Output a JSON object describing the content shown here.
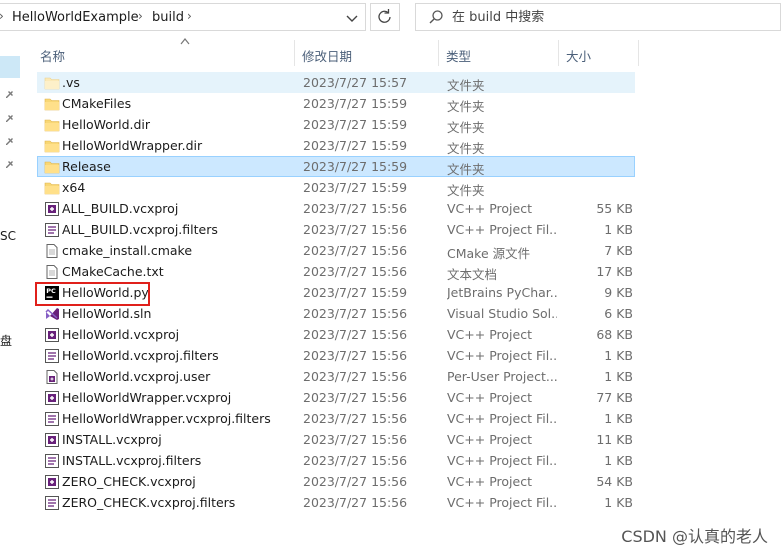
{
  "breadcrumb": {
    "items": [
      "HelloWorldExample",
      "build"
    ]
  },
  "search": {
    "placeholder": "在 build 中搜索"
  },
  "nav": {
    "partial_labels": [
      "SC",
      "盘"
    ]
  },
  "columns": {
    "name": "名称",
    "date": "修改日期",
    "type": "类型",
    "size": "大小"
  },
  "files": [
    {
      "name": ".vs",
      "date": "2023/7/27 15:57",
      "type": "文件夹",
      "size": "",
      "icon": "folder-light-icon",
      "state": "hover"
    },
    {
      "name": "CMakeFiles",
      "date": "2023/7/27 15:59",
      "type": "文件夹",
      "size": "",
      "icon": "folder-icon",
      "state": ""
    },
    {
      "name": "HelloWorld.dir",
      "date": "2023/7/27 15:59",
      "type": "文件夹",
      "size": "",
      "icon": "folder-icon",
      "state": ""
    },
    {
      "name": "HelloWorldWrapper.dir",
      "date": "2023/7/27 15:59",
      "type": "文件夹",
      "size": "",
      "icon": "folder-icon",
      "state": ""
    },
    {
      "name": "Release",
      "date": "2023/7/27 15:59",
      "type": "文件夹",
      "size": "",
      "icon": "folder-icon",
      "state": "selected"
    },
    {
      "name": "x64",
      "date": "2023/7/27 15:59",
      "type": "文件夹",
      "size": "",
      "icon": "folder-icon",
      "state": ""
    },
    {
      "name": "ALL_BUILD.vcxproj",
      "date": "2023/7/27 15:56",
      "type": "VC++ Project",
      "size": "55 KB",
      "icon": "vcxproj-icon",
      "state": ""
    },
    {
      "name": "ALL_BUILD.vcxproj.filters",
      "date": "2023/7/27 15:56",
      "type": "VC++ Project Fil...",
      "size": "1 KB",
      "icon": "filters-icon",
      "state": ""
    },
    {
      "name": "cmake_install.cmake",
      "date": "2023/7/27 15:56",
      "type": "CMake 源文件",
      "size": "7 KB",
      "icon": "text-file-icon",
      "state": ""
    },
    {
      "name": "CMakeCache.txt",
      "date": "2023/7/27 15:56",
      "type": "文本文档",
      "size": "17 KB",
      "icon": "text-file-icon",
      "state": ""
    },
    {
      "name": "HelloWorld.py",
      "date": "2023/7/27 15:59",
      "type": "JetBrains PyChar...",
      "size": "9 KB",
      "icon": "pycharm-icon",
      "state": ""
    },
    {
      "name": "HelloWorld.sln",
      "date": "2023/7/27 15:56",
      "type": "Visual Studio Sol...",
      "size": "6 KB",
      "icon": "sln-icon",
      "state": ""
    },
    {
      "name": "HelloWorld.vcxproj",
      "date": "2023/7/27 15:56",
      "type": "VC++ Project",
      "size": "68 KB",
      "icon": "vcxproj-icon",
      "state": ""
    },
    {
      "name": "HelloWorld.vcxproj.filters",
      "date": "2023/7/27 15:56",
      "type": "VC++ Project Fil...",
      "size": "1 KB",
      "icon": "filters-icon",
      "state": ""
    },
    {
      "name": "HelloWorld.vcxproj.user",
      "date": "2023/7/27 15:56",
      "type": "Per-User Project...",
      "size": "1 KB",
      "icon": "user-file-icon",
      "state": ""
    },
    {
      "name": "HelloWorldWrapper.vcxproj",
      "date": "2023/7/27 15:56",
      "type": "VC++ Project",
      "size": "77 KB",
      "icon": "vcxproj-icon",
      "state": ""
    },
    {
      "name": "HelloWorldWrapper.vcxproj.filters",
      "date": "2023/7/27 15:56",
      "type": "VC++ Project Fil...",
      "size": "1 KB",
      "icon": "filters-icon",
      "state": ""
    },
    {
      "name": "INSTALL.vcxproj",
      "date": "2023/7/27 15:56",
      "type": "VC++ Project",
      "size": "11 KB",
      "icon": "vcxproj-icon",
      "state": ""
    },
    {
      "name": "INSTALL.vcxproj.filters",
      "date": "2023/7/27 15:56",
      "type": "VC++ Project Fil...",
      "size": "1 KB",
      "icon": "filters-icon",
      "state": ""
    },
    {
      "name": "ZERO_CHECK.vcxproj",
      "date": "2023/7/27 15:56",
      "type": "VC++ Project",
      "size": "54 KB",
      "icon": "vcxproj-icon",
      "state": ""
    },
    {
      "name": "ZERO_CHECK.vcxproj.filters",
      "date": "2023/7/27 15:56",
      "type": "VC++ Project Fil...",
      "size": "1 KB",
      "icon": "filters-icon",
      "state": ""
    }
  ],
  "watermark": "CSDN @认真的老人",
  "colors": {
    "selected_bg": "#cce8ff",
    "selected_border": "#99d1ff",
    "hover_bg": "#e5f3fb",
    "highlight_box": "#e0201b",
    "folder": "#f8d775"
  }
}
